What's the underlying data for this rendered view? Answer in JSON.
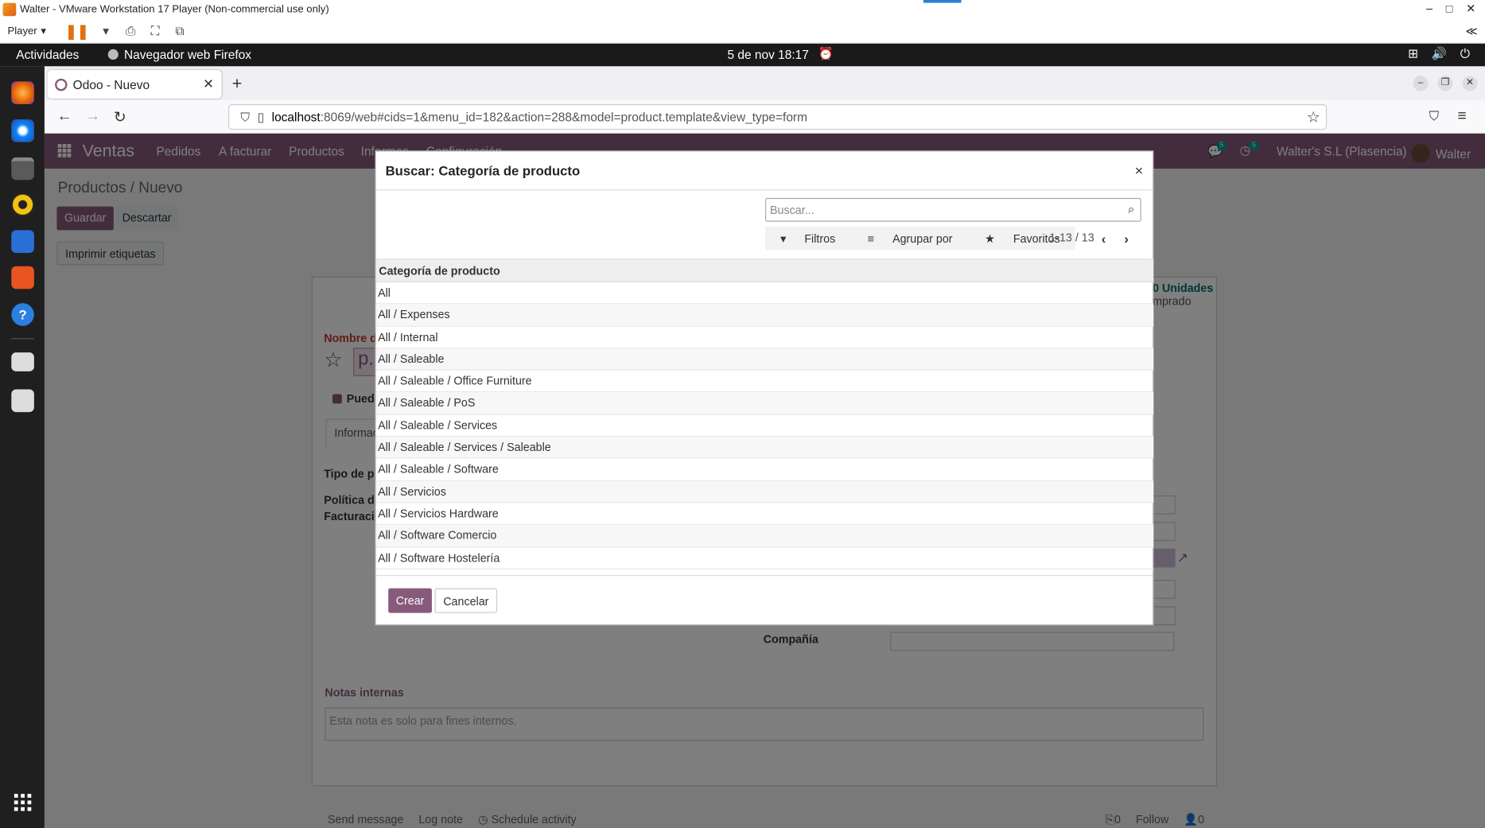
{
  "vmware": {
    "title": "Walter - VMware Workstation 17 Player (Non-commercial use only)",
    "player_label": "Player",
    "controls": [
      "–",
      "□",
      "✕"
    ],
    "collapse": "≪"
  },
  "gnome": {
    "activities": "Actividades",
    "app_name": "Navegador web Firefox",
    "clock": "5 de nov  18:17"
  },
  "browser": {
    "tab_title": "Odoo - Nuevo",
    "url_host": "localhost",
    "url_rest": ":8069/web#cids=1&menu_id=182&action=288&model=product.template&view_type=form"
  },
  "odoo": {
    "brand": "Ventas",
    "menu": [
      "Pedidos",
      "A facturar",
      "Productos",
      "Informes",
      "Configuración"
    ],
    "badges": [
      "5",
      "5"
    ],
    "company": "Walter's S.L (Plasencia)",
    "user": "Walter",
    "breadcrumb_parent": "Productos",
    "breadcrumb_sep": " / ",
    "breadcrumb_current": "Nuevo",
    "save": "Guardar",
    "discard": "Descartar",
    "print_labels": "Imprimir etiquetas",
    "units_value": "0 Unidades",
    "units_label": "mprado",
    "product_name_label": "Nombre de",
    "product_name_placeholder": "p.",
    "can_sell_label": "Puede",
    "info_tab": "Informac",
    "type_label": "Tipo de pr",
    "policy_label_1": "Política de",
    "policy_label_2": "Facturació",
    "company_label": "Compañía",
    "notes_label": "Notas internas",
    "notes_placeholder": "Esta nota es solo para fines internos.",
    "chatter_left": [
      "Send message",
      "Log note",
      "Schedule activity"
    ],
    "chatter_right": [
      "0",
      "Follow",
      "0"
    ]
  },
  "modal": {
    "title": "Buscar: Categoría de producto",
    "close": "×",
    "search_placeholder": "Buscar...",
    "filters": "Filtros",
    "group_by": "Agrupar por",
    "favorites": "Favoritos",
    "pager": "1-13 / 13",
    "column_header": "Categoría de producto",
    "rows": [
      "All",
      "All / Expenses",
      "All / Internal",
      "All / Saleable",
      "All / Saleable / Office Furniture",
      "All / Saleable / PoS",
      "All / Saleable / Services",
      "All / Saleable / Services / Saleable",
      "All / Saleable / Software",
      "All / Servicios",
      "All / Servicios Hardware",
      "All / Software Comercio",
      "All / Software Hostelería"
    ],
    "create": "Crear",
    "cancel": "Cancelar"
  },
  "colors": {
    "odoo_primary": "#875a7b",
    "accent_teal": "#00a09d"
  }
}
